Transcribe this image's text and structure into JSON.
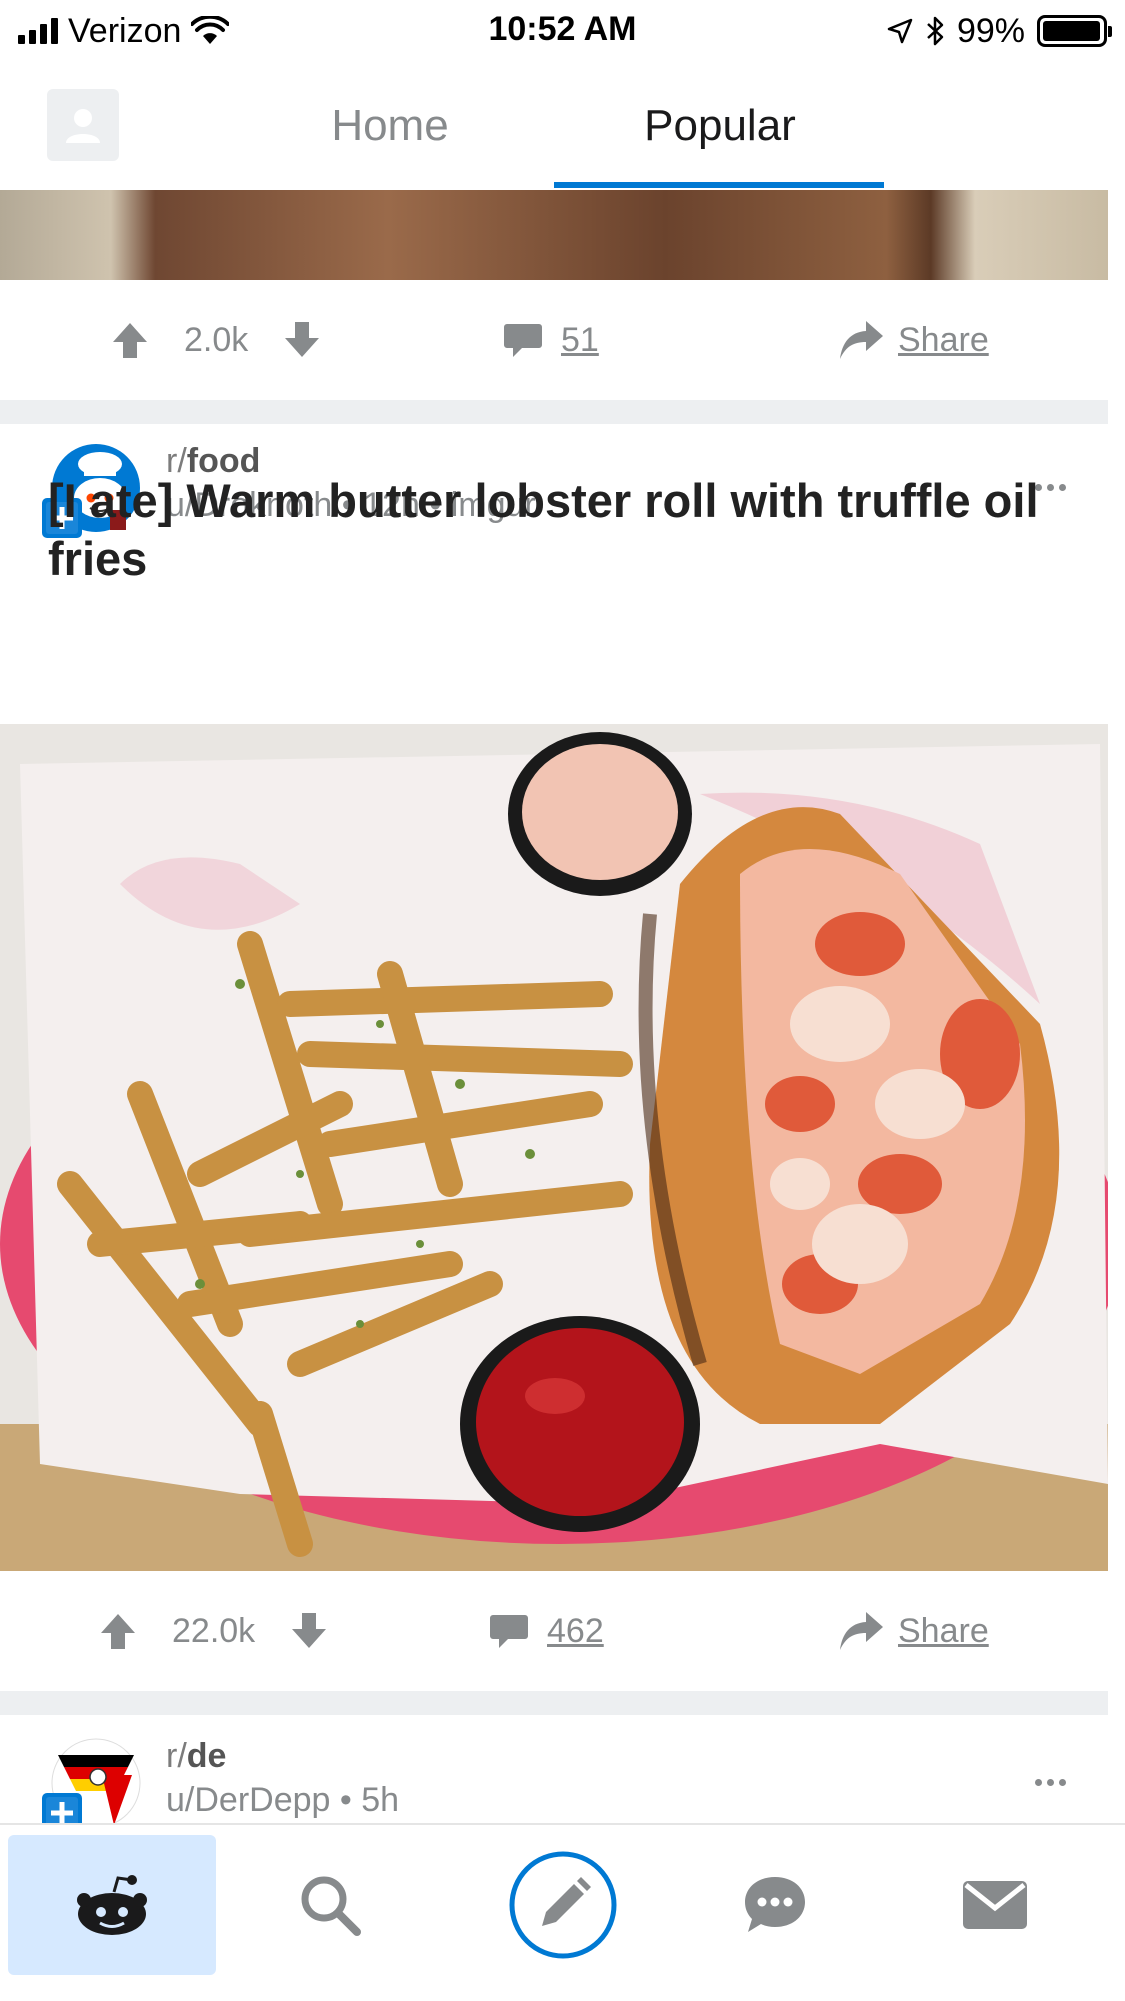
{
  "status_bar": {
    "carrier": "Verizon",
    "time": "10:52 AM",
    "battery": "99%",
    "battery_level": 0.99,
    "icons": [
      "signal-icon",
      "wifi-icon",
      "location-arrow-icon",
      "bluetooth-icon",
      "battery-icon"
    ]
  },
  "header": {
    "tabs": [
      {
        "label": "Home",
        "active": false
      },
      {
        "label": "Popular",
        "active": true
      }
    ],
    "accent": "#0079d3"
  },
  "posts": [
    {
      "upvotes": "2.0k",
      "comments": "51",
      "share_label": "Share"
    },
    {
      "subreddit_prefix": "r/",
      "subreddit": "food",
      "author": "u/Droknoth",
      "age": "12h",
      "source": "imgur",
      "title": "[I ate] Warm butter lobster roll with truffle oil fries",
      "upvotes": "22.0k",
      "comments": "462",
      "share_label": "Share"
    },
    {
      "subreddit_prefix": "r/",
      "subreddit": "de",
      "author": "u/DerDepp",
      "age": "5h"
    }
  ],
  "bottom_nav": {
    "items": [
      "reddit-home-icon",
      "search-icon",
      "compose-icon",
      "chat-icon",
      "mail-icon"
    ],
    "active": "reddit-home-icon"
  },
  "colors": {
    "accent_blue": "#0079d3",
    "join_blue": "#0079d3",
    "muted_text": "#878a8c",
    "separator": "#edeff1"
  }
}
